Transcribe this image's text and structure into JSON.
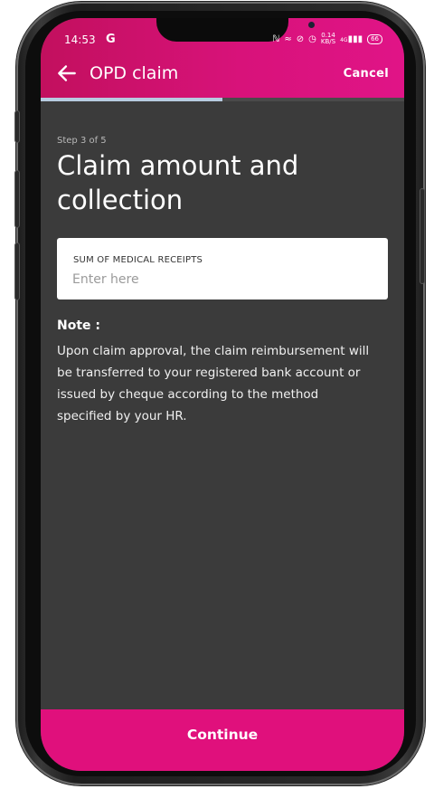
{
  "status_bar": {
    "time": "14:53",
    "g_icon": "G",
    "speed_value": "0.14",
    "speed_unit": "KB/S",
    "network": "4G",
    "battery": "66"
  },
  "appbar": {
    "back_icon": "arrow-left-icon",
    "title": "OPD claim",
    "cancel_label": "Cancel"
  },
  "progress": {
    "current_step": 3,
    "total_steps": 5,
    "fraction": 0.5
  },
  "step_text": "Step 3 of 5",
  "page_title": "Claim amount and collection",
  "receipts_field": {
    "label": "SUM OF MEDICAL RECEIPTS",
    "placeholder": "Enter here",
    "value": ""
  },
  "note": {
    "heading": "Note :",
    "body": "Upon claim approval, the claim reimbursement will be transferred to your registered bank account or issued by cheque according to the method specified by your HR."
  },
  "continue_label": "Continue",
  "colors": {
    "brand": "#e0107c",
    "background": "#3b3b3b",
    "progress": "#b7cbe0"
  }
}
